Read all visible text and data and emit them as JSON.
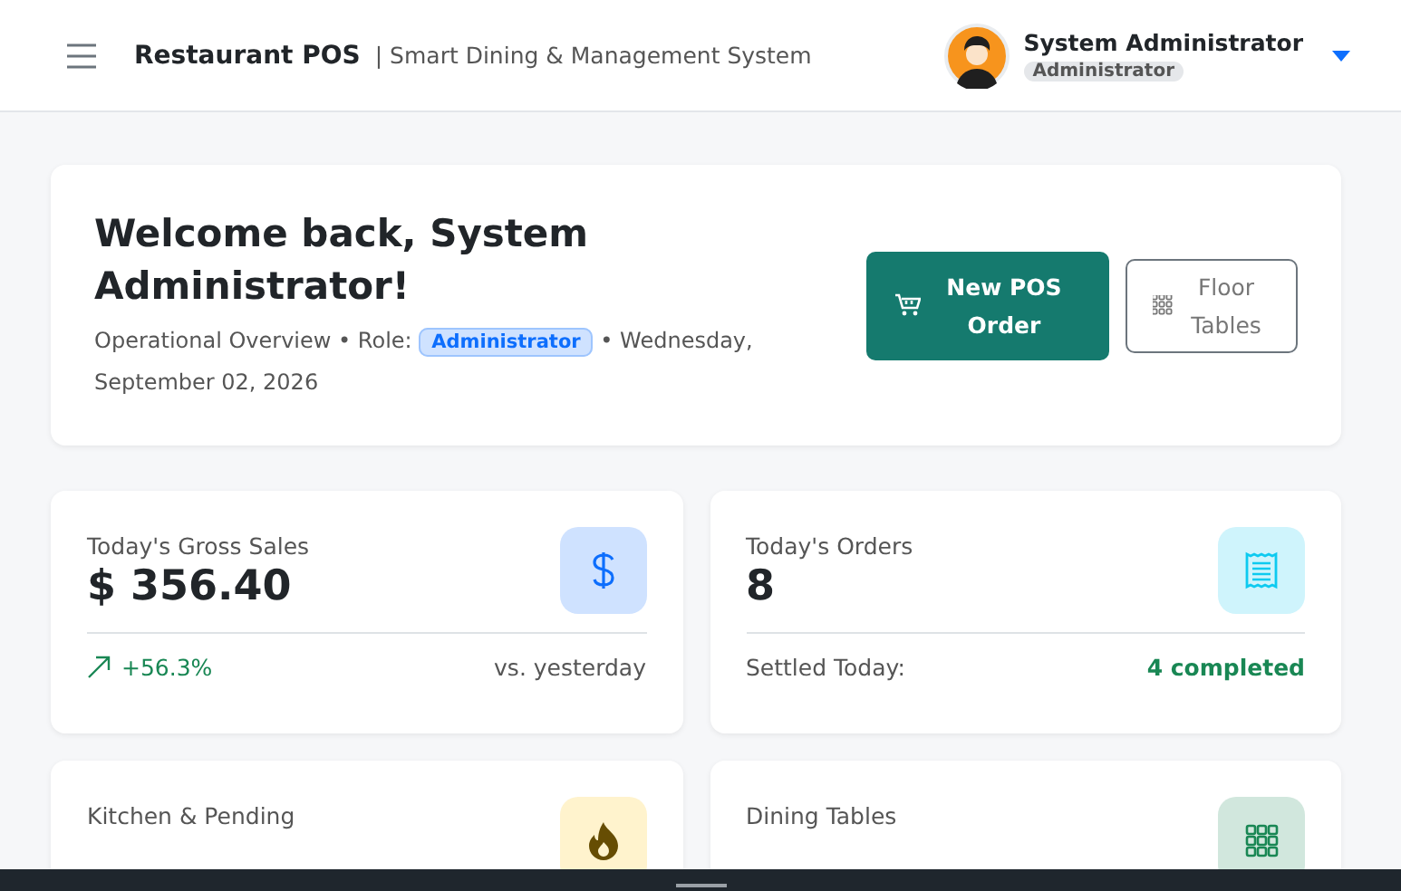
{
  "header": {
    "app_name": "Restaurant POS",
    "tagline": "| Smart Dining & Management System",
    "user": {
      "name": "System Administrator",
      "role": "Administrator"
    }
  },
  "welcome": {
    "title": "Welcome back, System Administrator!",
    "overview": "Operational Overview • Role:",
    "role_badge": "Administrator",
    "date": "• Wednesday, September 02, 2026",
    "buttons": [
      {
        "kind": "primary",
        "label": "New POS Order"
      },
      {
        "kind": "outline",
        "label": "Floor Tables"
      }
    ]
  },
  "stats": [
    {
      "kind": "sales",
      "title": "Today's Gross Sales",
      "value": "$ 356.40",
      "color": "#cfe2ff",
      "footer": {
        "kind": "trend",
        "left": "+56.3%",
        "right": "vs. yesterday"
      }
    },
    {
      "kind": "orders",
      "title": "Today's Orders",
      "value": "8",
      "color": "#cff4fc",
      "footer": {
        "kind": "settled",
        "left": "Settled Today:",
        "right": "4 completed"
      }
    },
    {
      "kind": "kitchen",
      "title": "Kitchen & Pending",
      "color": "#fff3cd"
    },
    {
      "kind": "tables",
      "title": "Dining Tables",
      "color": "#d1e7dd"
    }
  ]
}
